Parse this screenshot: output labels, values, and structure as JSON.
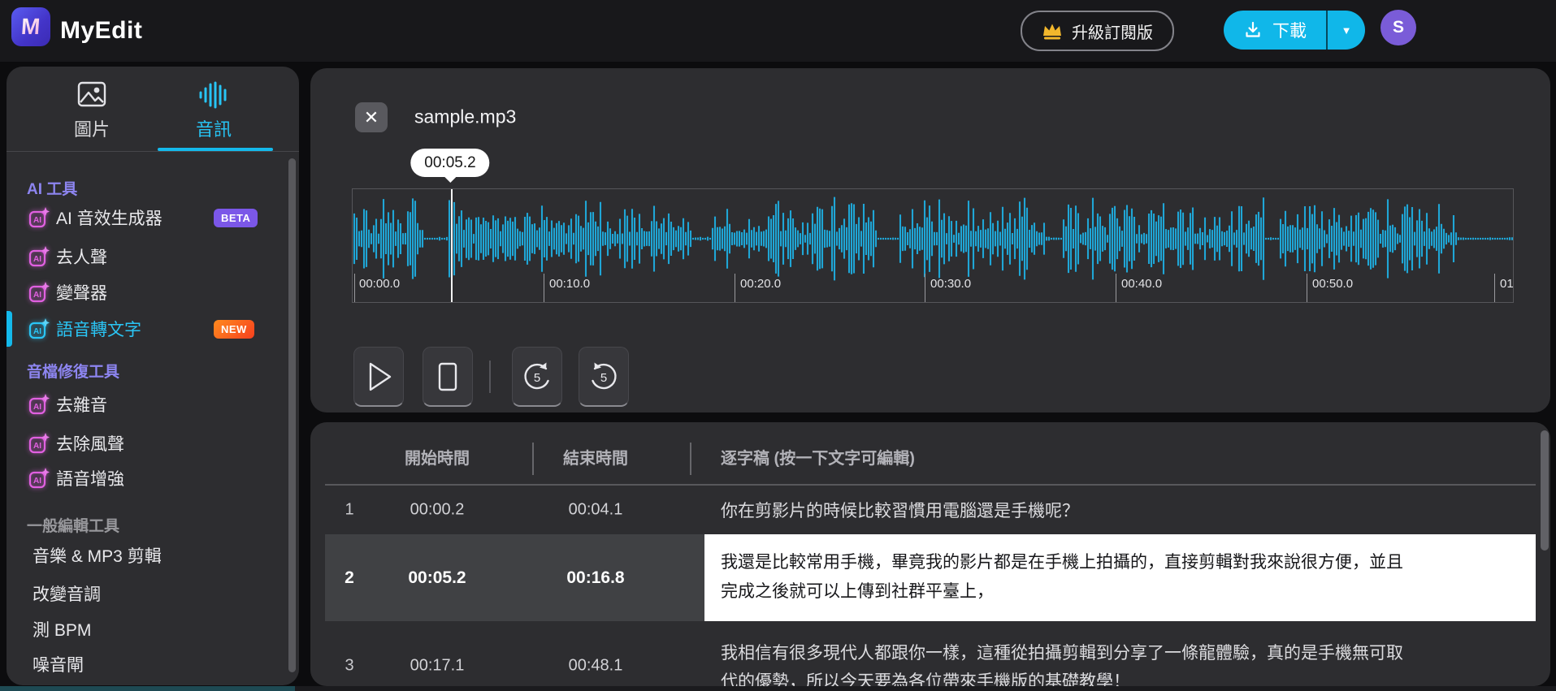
{
  "topbar": {
    "brand": "MyEdit",
    "logo_letter": "M",
    "upgrade_label": "升級訂閱版",
    "download_label": "下載",
    "caret": "▼",
    "avatar_initial": "S"
  },
  "sidebar": {
    "tabs": [
      {
        "label": "圖片",
        "icon": "image-icon",
        "active": false
      },
      {
        "label": "音訊",
        "icon": "audio-wave-icon",
        "active": true
      }
    ],
    "sections": [
      {
        "label": "AI 工具",
        "items": [
          {
            "label": "AI 音效生成器",
            "icon": "ai-sparkle-icon",
            "badge": "BETA"
          },
          {
            "label": "去人聲",
            "icon": "ai-sparkle-icon"
          },
          {
            "label": "變聲器",
            "icon": "ai-sparkle-icon"
          },
          {
            "label": "語音轉文字",
            "icon": "ai-sparkle-icon",
            "badge": "NEW",
            "active": true
          }
        ]
      },
      {
        "label": "音檔修復工具",
        "items": [
          {
            "label": "去雜音",
            "icon": "ai-sparkle-icon"
          },
          {
            "label": "去除風聲",
            "icon": "ai-sparkle-icon"
          },
          {
            "label": "語音增強",
            "icon": "ai-sparkle-icon"
          }
        ]
      },
      {
        "label": "一般編輯工具",
        "items": [
          {
            "label": "音樂 & MP3 剪輯"
          },
          {
            "label": "改變音調"
          },
          {
            "label": "測 BPM"
          },
          {
            "label": "噪音閘"
          }
        ]
      }
    ]
  },
  "player": {
    "filename": "sample.mp3",
    "current_time": "00:05.2",
    "playhead_fraction": 0.0846,
    "timeline_ticks": [
      "00:00.0",
      "00:10.0",
      "00:20.0",
      "00:30.0",
      "00:40.0",
      "00:50.0",
      "01"
    ],
    "controls": [
      "play-icon",
      "stop-icon",
      "replay-5-icon",
      "forward-5-icon"
    ],
    "skip_seconds": "5"
  },
  "transcript": {
    "headers": {
      "start": "開始時間",
      "end": "結束時間",
      "text": "逐字稿 (按一下文字可編輯)"
    },
    "rows": [
      {
        "index": "1",
        "start": "00:00.2",
        "end": "00:04.1",
        "text": "你在剪影片的時候比較習慣用電腦還是手機呢？",
        "selected": false
      },
      {
        "index": "2",
        "start": "00:05.2",
        "end": "00:16.8",
        "text_line1": "我還是比較常用手機，畢竟我的影片都是在手機上拍攝的，直接剪輯對我來說很方便，並且",
        "text_line2": "完成之後就可以上傳到社群平臺上，",
        "selected": true
      },
      {
        "index": "3",
        "start": "00:17.1",
        "end": "00:48.1",
        "text_line1": "我相信有很多現代人都跟你一樣，這種從拍攝剪輯到分享了一條龍體驗，真的是手機無可取",
        "text_line2": "代的優勢，所以今天要為各位帶來手機版的基礎教學！",
        "selected": false
      }
    ]
  },
  "colors": {
    "accent_cyan": "#14b9eb",
    "waveform_cyan": "#1fa6d6",
    "section_purple": "#8d85f0",
    "beta_badge": "#7b57e8",
    "new_badge": "#f6511e",
    "crown_gold": "#f2b72c",
    "avatar_purple": "#7a5cd8",
    "selected_row_bg": "#ffffff",
    "panel_bg": "#2d2d30"
  }
}
